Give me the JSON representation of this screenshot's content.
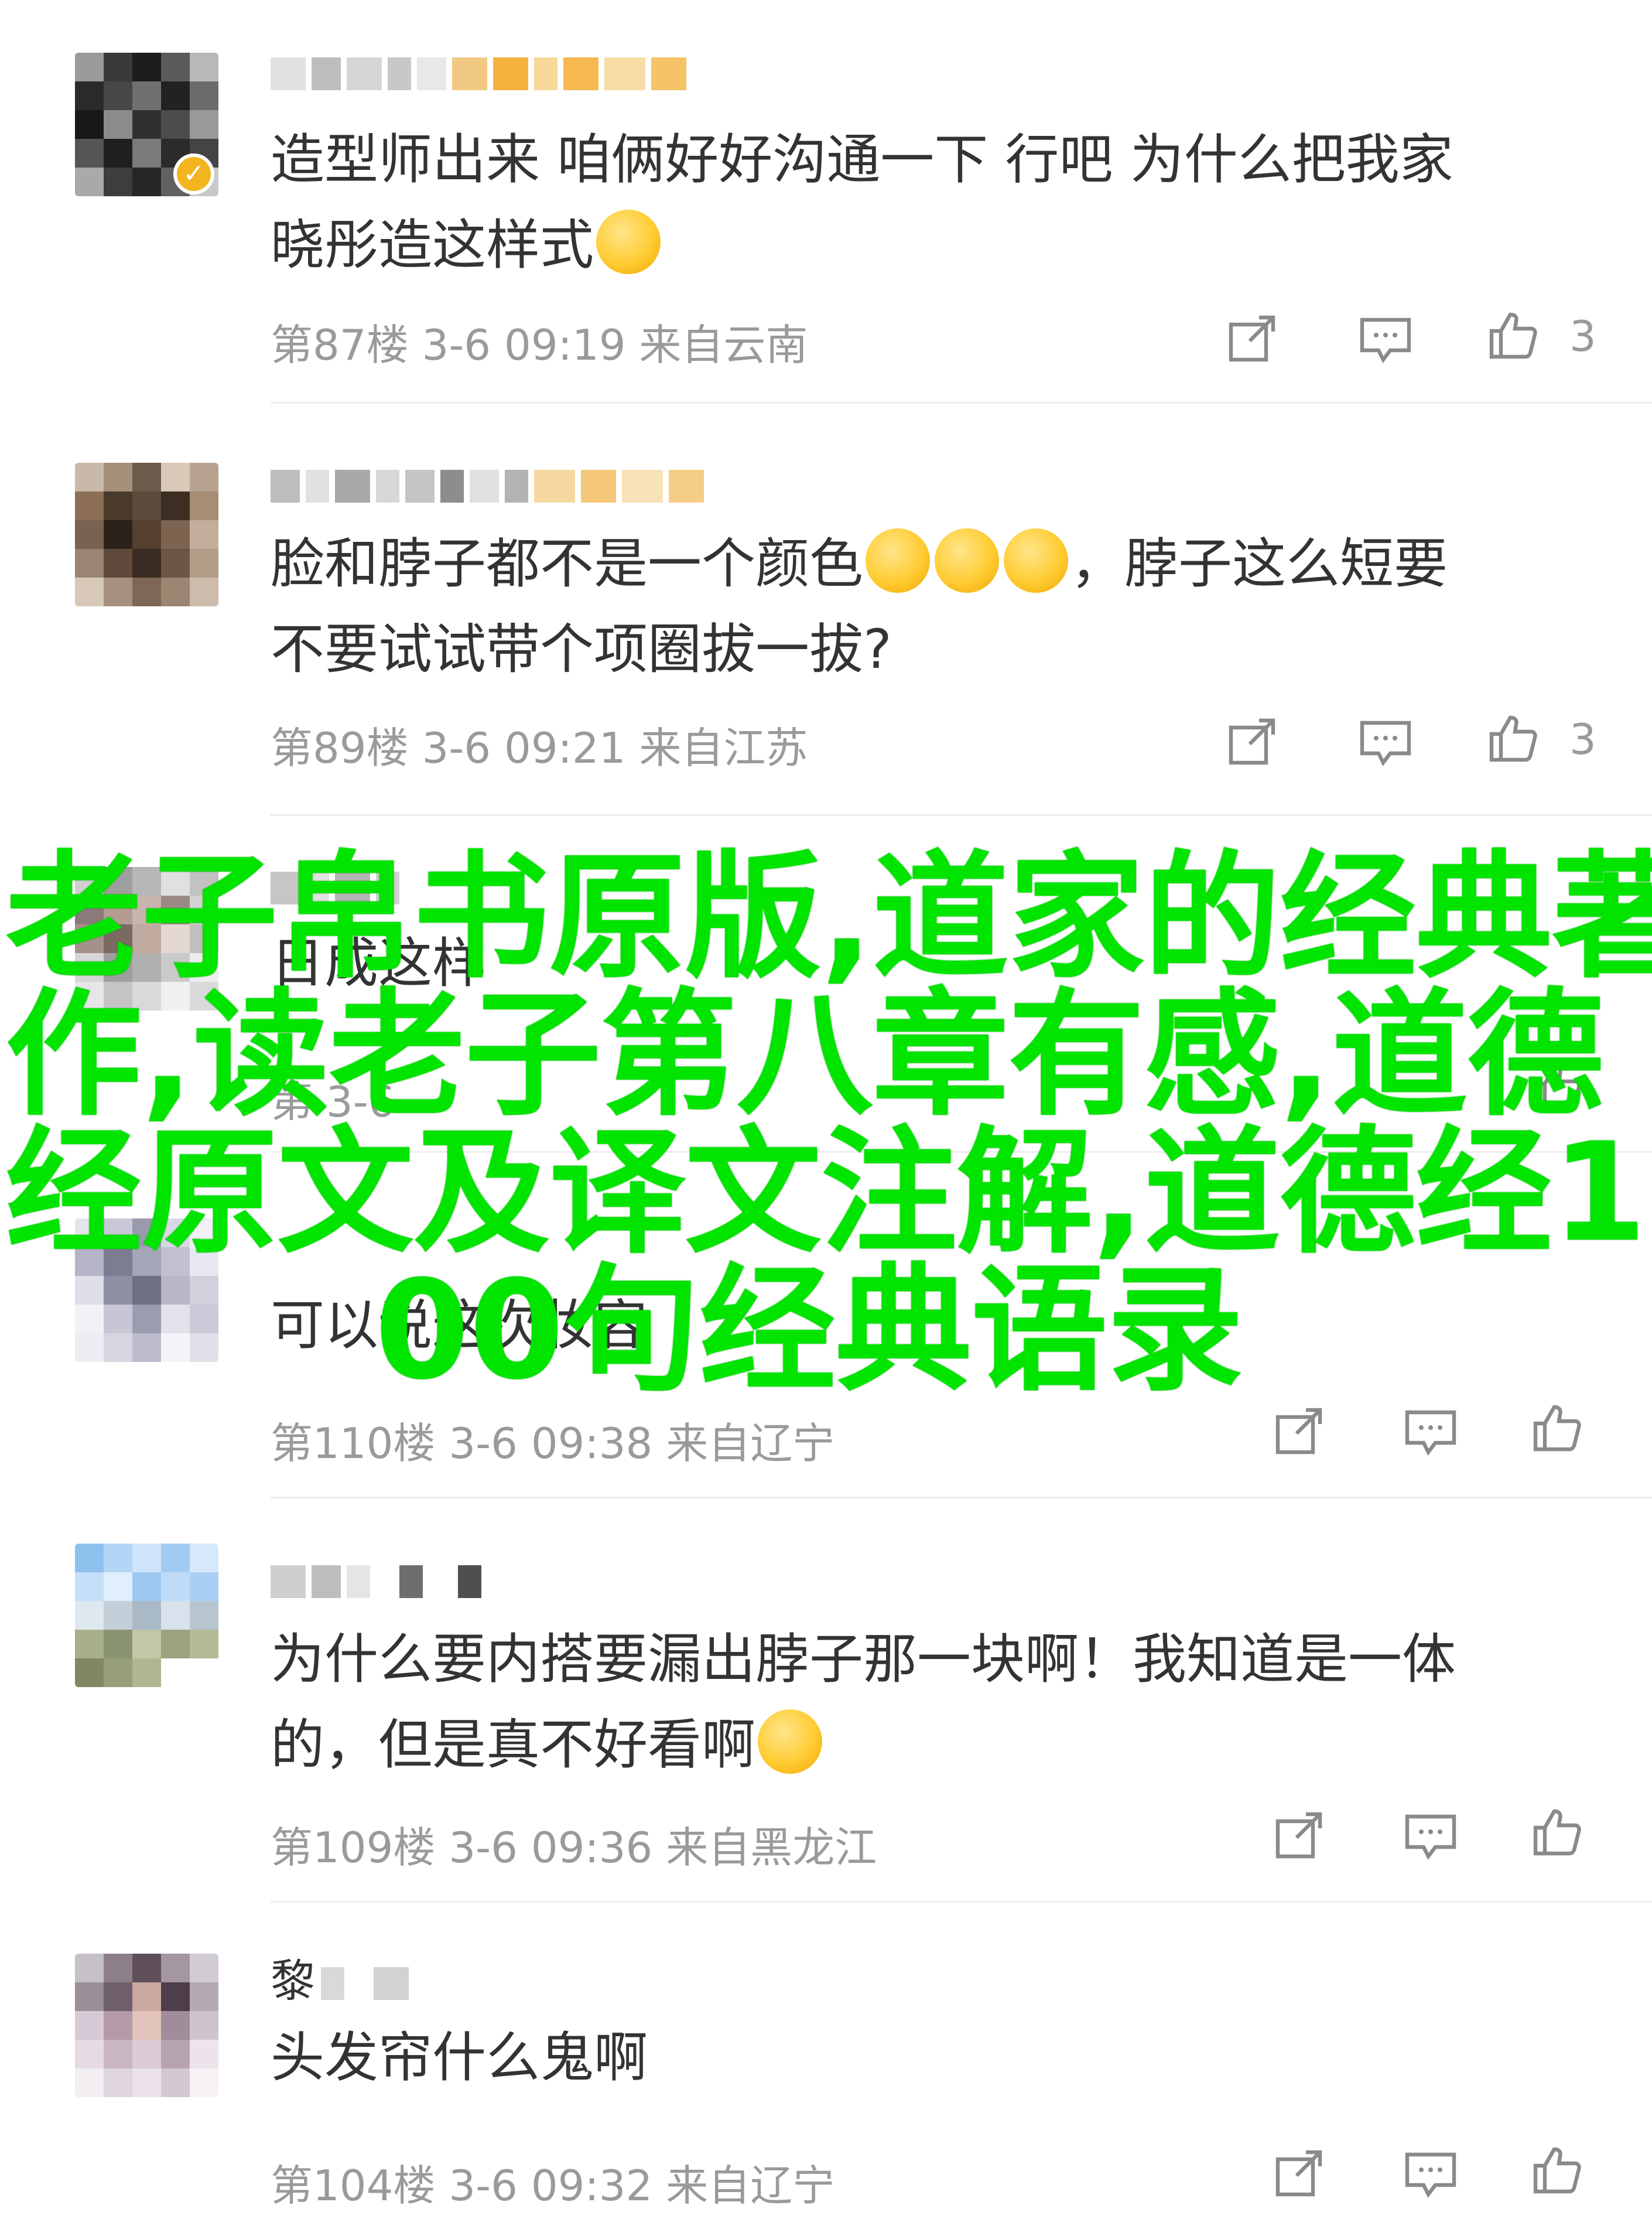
{
  "comments": [
    {
      "body": "造型师出来 咱俩好好沟通一下 行吧 为什么把我家\n晓彤造这样式",
      "emoji_icons": [
        "crying-emoji-icon"
      ],
      "floor": "第87楼",
      "date": "3-6",
      "time": "09:19",
      "location": "来自云南",
      "likes": "3",
      "verified": true
    },
    {
      "body": "脸和脖子都不是一个颜色",
      "body_2": "，脖子这么短要\n不要试试带个项圈拔一拔?",
      "emoji_icons": [
        "sleepy-emoji-icon",
        "sleepy-emoji-icon",
        "sleepy-emoji-icon"
      ],
      "floor": "第89楼",
      "date": "3-6",
      "time": "09:21",
      "location": "来自江苏",
      "likes": "3"
    },
    {
      "body": "可以说这次妆容",
      "floor": "第110楼",
      "date": "3-6",
      "time": "09:38",
      "location": "来自辽宁",
      "likes": ""
    },
    {
      "body": "为什么要内搭要漏出脖子那一块啊！我知道是一体\n的，但是真不好看啊",
      "emoji_icons": [
        "sweat-smile-emoji-icon"
      ],
      "floor": "第109楼",
      "date": "3-6",
      "time": "09:36",
      "location": "来自黑龙江",
      "likes": ""
    },
    {
      "name": "黎",
      "body": "头发帘什么鬼啊",
      "floor": "第104楼",
      "date": "3-6",
      "time": "09:32",
      "location": "来自辽宁",
      "likes": ""
    }
  ],
  "partial": {
    "body": "日成这样",
    "floor": "第",
    "time": "3-6"
  },
  "overlay_title": {
    "lines": [
      "老子帛书原版,道家的经典著",
      "作,读老子第八章有感,道德",
      "经原文及译文注解,道德经1",
      "00句经典语录"
    ]
  },
  "colors": {
    "overlay_text": "#00e400",
    "meta_text": "#9a9a9a",
    "body_text": "#333333",
    "verified_badge": "#f3b51f"
  }
}
